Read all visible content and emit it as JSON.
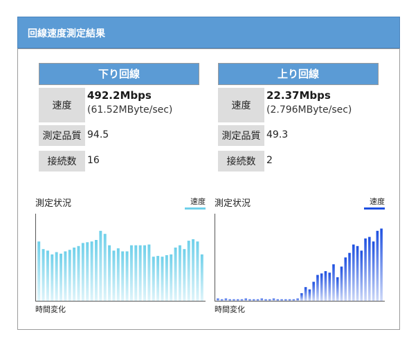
{
  "panel": {
    "title": "回線速度測定結果"
  },
  "download": {
    "title": "下り回線",
    "speed_label": "速度",
    "speed_main": "492.2Mbps",
    "speed_sub": "(61.52MByte/sec)",
    "quality_label": "測定品質",
    "quality_value": "94.5",
    "conn_label": "接続数",
    "conn_value": "16"
  },
  "upload": {
    "title": "上り回線",
    "speed_label": "速度",
    "speed_main": "22.37Mbps",
    "speed_sub": "(2.796MByte/sec)",
    "quality_label": "測定品質",
    "quality_value": "49.3",
    "conn_label": "接続数",
    "conn_value": "2"
  },
  "chart_data": [
    {
      "type": "bar",
      "title": "測定状況",
      "xlabel": "時間変化",
      "ylabel": "",
      "legend": [
        "速度"
      ],
      "series": [
        {
          "name": "速度",
          "color": "#6fd0ea",
          "values": [
            0.78,
            0.68,
            0.66,
            0.61,
            0.64,
            0.62,
            0.65,
            0.67,
            0.7,
            0.72,
            0.76,
            0.77,
            0.78,
            0.8,
            0.92,
            0.88,
            0.73,
            0.66,
            0.69,
            0.65,
            0.65,
            0.73,
            0.73,
            0.73,
            0.73,
            0.74,
            0.58,
            0.59,
            0.58,
            0.6,
            0.61,
            0.7,
            0.73,
            0.68,
            0.79,
            0.81,
            0.78,
            0.61
          ]
        }
      ],
      "ylim": [
        0,
        1
      ],
      "grid": false,
      "legend_position": "top-right"
    },
    {
      "type": "bar",
      "title": "測定状況",
      "xlabel": "時間変化",
      "ylabel": "",
      "legend": [
        "速度"
      ],
      "series": [
        {
          "name": "速度",
          "color": "#1d4fe0",
          "values": [
            0.03,
            0.02,
            0.03,
            0.02,
            0.02,
            0.02,
            0.02,
            0.03,
            0.02,
            0.02,
            0.02,
            0.03,
            0.02,
            0.02,
            0.03,
            0.02,
            0.02,
            0.02,
            0.02,
            0.02,
            0.03,
            0.1,
            0.18,
            0.15,
            0.25,
            0.34,
            0.36,
            0.39,
            0.37,
            0.48,
            0.31,
            0.45,
            0.57,
            0.63,
            0.74,
            0.72,
            0.66,
            0.82,
            0.84,
            0.78,
            0.92,
            0.95
          ]
        }
      ],
      "ylim": [
        0,
        1
      ],
      "grid": false,
      "legend_position": "top-right"
    }
  ]
}
